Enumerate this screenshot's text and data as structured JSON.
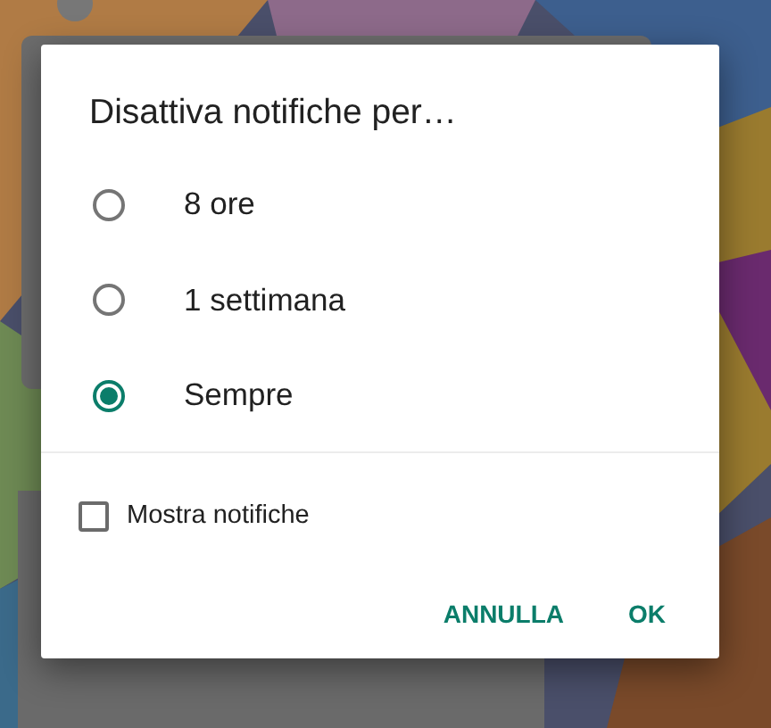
{
  "dialog": {
    "title": "Disattiva notifiche per…",
    "options": [
      {
        "label": "8 ore",
        "selected": false
      },
      {
        "label": "1 settimana",
        "selected": false
      },
      {
        "label": "Sempre",
        "selected": true
      }
    ],
    "checkbox": {
      "label": "Mostra notifiche",
      "checked": false
    },
    "buttons": [
      "ANNULLA",
      "OK"
    ]
  }
}
